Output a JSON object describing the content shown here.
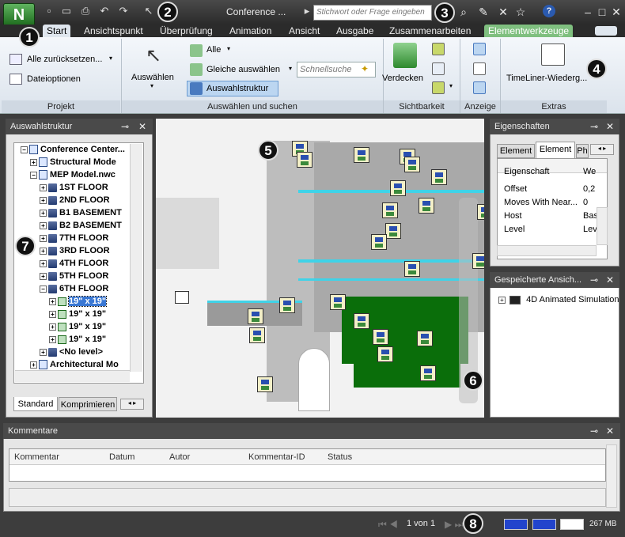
{
  "titlebar": {
    "doc_title": "Conference ...",
    "search_placeholder": "Stichwort oder Frage eingeben",
    "help_label": "?"
  },
  "tabs": [
    {
      "label": "Start"
    },
    {
      "label": "Ansichtspunkt"
    },
    {
      "label": "Überprüfung"
    },
    {
      "label": "Animation"
    },
    {
      "label": "Ansicht"
    },
    {
      "label": "Ausgabe"
    },
    {
      "label": "Zusammenarbeiten"
    },
    {
      "label": "Elementwerkzeuge"
    }
  ],
  "ribbon": {
    "projekt": {
      "reset_all": "Alle zurücksetzen...",
      "file_options": "Dateioptionen",
      "group_label": "Projekt"
    },
    "auswaehlen": {
      "select": "Auswählen",
      "all": "Alle",
      "same_select": "Gleiche auswählen",
      "quick_search_placeholder": "Schnellsuche",
      "selection_tree": "Auswahlstruktur",
      "group_label": "Auswählen und suchen"
    },
    "sichtbarkeit": {
      "hide": "Verdecken",
      "group_label": "Sichtbarkeit"
    },
    "anzeige": {
      "group_label": "Anzeige"
    },
    "extras": {
      "timeliner": "TimeLiner-Wiederg...",
      "group_label": "Extras"
    }
  },
  "selection_tree": {
    "title": "Auswahlstruktur",
    "items": [
      {
        "label": "Conference Center...",
        "indent": 0,
        "icon": "file"
      },
      {
        "label": "Structural Mode",
        "indent": 1,
        "icon": "file"
      },
      {
        "label": "MEP Model.nwc",
        "indent": 1,
        "icon": "file"
      },
      {
        "label": "1ST FLOOR",
        "indent": 2,
        "icon": "layer"
      },
      {
        "label": "2ND FLOOR",
        "indent": 2,
        "icon": "layer"
      },
      {
        "label": "B1 BASEMENT",
        "indent": 2,
        "icon": "layer"
      },
      {
        "label": "B2  BASEMENT",
        "indent": 2,
        "icon": "layer"
      },
      {
        "label": "7TH FLOOR",
        "indent": 2,
        "icon": "layer"
      },
      {
        "label": "3RD FLOOR",
        "indent": 2,
        "icon": "layer"
      },
      {
        "label": "4TH FLOOR",
        "indent": 2,
        "icon": "layer"
      },
      {
        "label": "5TH FLOOR",
        "indent": 2,
        "icon": "layer"
      },
      {
        "label": "6TH FLOOR",
        "indent": 2,
        "icon": "layer"
      },
      {
        "label": "19\" x 19\"",
        "indent": 3,
        "icon": "item",
        "selected": true
      },
      {
        "label": "19\" x 19\"",
        "indent": 3,
        "icon": "item"
      },
      {
        "label": "19\" x 19\"",
        "indent": 3,
        "icon": "item"
      },
      {
        "label": "19\" x 19\"",
        "indent": 3,
        "icon": "item"
      },
      {
        "label": "<No level>",
        "indent": 2,
        "icon": "layer"
      },
      {
        "label": "Architectural Mo",
        "indent": 1,
        "icon": "file"
      }
    ],
    "tabs": [
      "Standard",
      "Komprimieren"
    ]
  },
  "properties": {
    "title": "Eigenschaften",
    "tabs": [
      "Element",
      "Element",
      "Ph"
    ],
    "header": [
      "Eigenschaft",
      "We"
    ],
    "rows": [
      [
        "Offset",
        "0,2"
      ],
      [
        "Moves With Near...",
        "0"
      ],
      [
        "Host",
        "Bas"
      ],
      [
        "Level",
        "Lev"
      ]
    ]
  },
  "saved_views": {
    "title": "Gespeicherte Ansich...",
    "items": [
      "4D Animated Simulation"
    ]
  },
  "comments": {
    "title": "Kommentare",
    "columns": [
      "Kommentar",
      "Datum",
      "Autor",
      "Kommentar-ID",
      "Status"
    ]
  },
  "statusbar": {
    "page": "1 von 1",
    "memory": "267 MB"
  },
  "callouts": [
    "1",
    "2",
    "3",
    "4",
    "5",
    "6",
    "7",
    "8"
  ]
}
